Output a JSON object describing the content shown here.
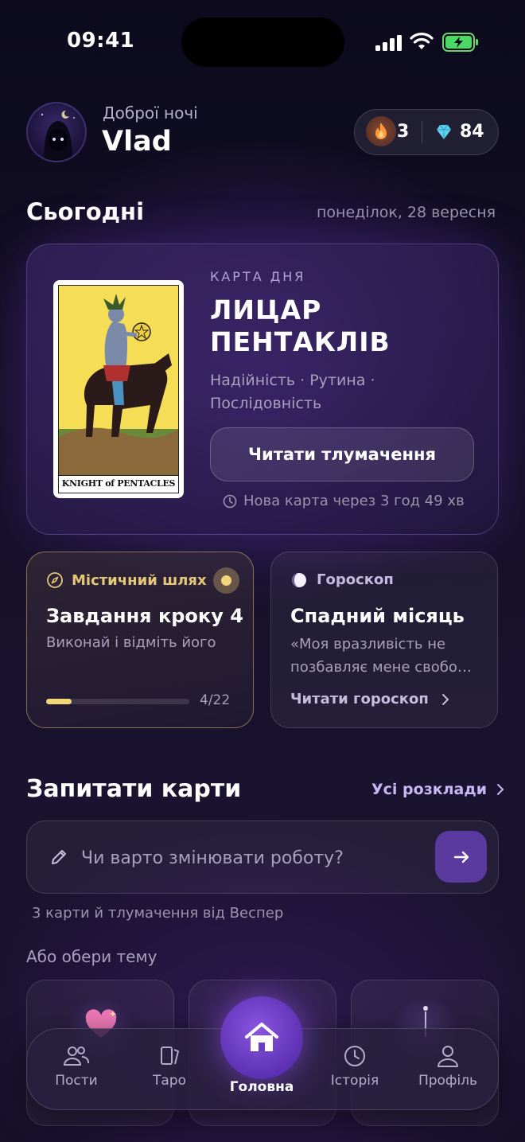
{
  "status_bar": {
    "time": "09:41"
  },
  "header": {
    "greeting": "Доброї ночі",
    "username": "Vlad",
    "streak": "3",
    "gems": "84"
  },
  "today": {
    "title": "Сьогодні",
    "date": "понеділок, 28 вересня"
  },
  "card_of_day": {
    "label": "КАРТА ДНЯ",
    "title": "ЛИЦАР ПЕНТАКЛІВ",
    "keywords": "Надійність · Рутина · Послідовність",
    "card_caption": "KNIGHT of PENTACLES",
    "read_button": "Читати тлумачення",
    "next_card": "Нова карта через 3 год 49 хв"
  },
  "mystic_path": {
    "label": "Містичний шлях",
    "title": "Завдання кроку 4",
    "subtitle": "Виконай і відміть його",
    "progress_text": "4/22",
    "progress_fraction": 0.18
  },
  "horoscope": {
    "label": "Гороскоп",
    "title": "Спадний місяць",
    "quote": "«Моя вразливість не позбавляє мене свобо…",
    "link": "Читати гороскоп"
  },
  "ask": {
    "title": "Запитати карти",
    "all_spreads": "Усі розклади",
    "placeholder": "Чи варто змінювати роботу?",
    "hint": "3 карти й тлумачення від Веспер",
    "themes_label": "Або обери тему"
  },
  "tabs": [
    "Пости",
    "Таро",
    "Головна",
    "Історія",
    "Профіль"
  ],
  "colors": {
    "accent": "#5b3aa0",
    "gold": "#f2d67a",
    "background": "#15102a"
  }
}
